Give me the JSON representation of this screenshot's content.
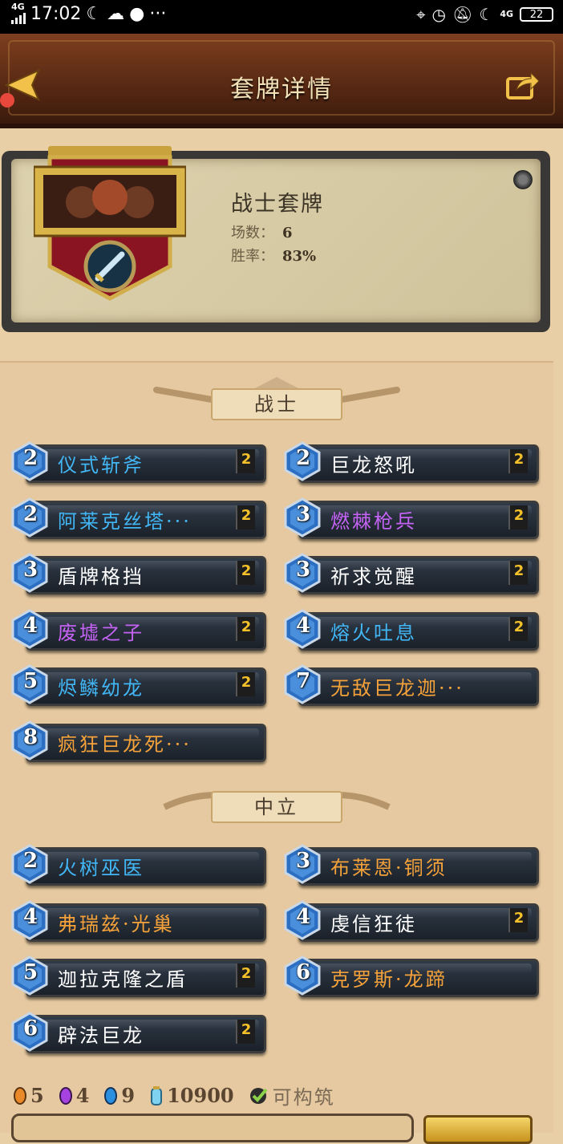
{
  "status_bar": {
    "network": "4G",
    "time": "17:02",
    "icons_left": [
      "moon-icon",
      "cloud-icon",
      "planet-icon",
      "more-icon"
    ],
    "icons_right": [
      "location-icon",
      "alarm-icon",
      "mute-icon",
      "moon-icon",
      "signal-icon"
    ],
    "net_right": "4G",
    "battery": "22"
  },
  "header": {
    "title": "套牌详情"
  },
  "deck": {
    "name": "战士套牌",
    "games_label": "场数：",
    "games_value": "6",
    "winrate_label": "胜率：",
    "winrate_value": "83%"
  },
  "sections": [
    {
      "title": "战士",
      "cards": [
        {
          "cost": "2",
          "name": "仪式斩斧",
          "count": "2",
          "rarity": "rare"
        },
        {
          "cost": "2",
          "name": "巨龙怒吼",
          "count": "2",
          "rarity": "common"
        },
        {
          "cost": "2",
          "name": "阿莱克丝塔···",
          "count": "2",
          "rarity": "rare"
        },
        {
          "cost": "3",
          "name": "燃棘枪兵",
          "count": "2",
          "rarity": "epic"
        },
        {
          "cost": "3",
          "name": "盾牌格挡",
          "count": "2",
          "rarity": "common"
        },
        {
          "cost": "3",
          "name": "祈求觉醒",
          "count": "2",
          "rarity": "common"
        },
        {
          "cost": "4",
          "name": "废墟之子",
          "count": "2",
          "rarity": "epic"
        },
        {
          "cost": "4",
          "name": "熔火吐息",
          "count": "2",
          "rarity": "rare"
        },
        {
          "cost": "5",
          "name": "烬鳞幼龙",
          "count": "2",
          "rarity": "rare"
        },
        {
          "cost": "7",
          "name": "无敌巨龙迦···",
          "count": "",
          "rarity": "legendary"
        },
        {
          "cost": "8",
          "name": "疯狂巨龙死···",
          "count": "",
          "rarity": "legendary"
        }
      ]
    },
    {
      "title": "中立",
      "cards": [
        {
          "cost": "2",
          "name": "火树巫医",
          "count": "",
          "rarity": "rare"
        },
        {
          "cost": "3",
          "name": "布莱恩·铜须",
          "count": "",
          "rarity": "legendary"
        },
        {
          "cost": "4",
          "name": "弗瑞兹·光巢",
          "count": "",
          "rarity": "legendary"
        },
        {
          "cost": "4",
          "name": "虔信狂徒",
          "count": "2",
          "rarity": "common"
        },
        {
          "cost": "5",
          "name": "迦拉克隆之盾",
          "count": "2",
          "rarity": "common"
        },
        {
          "cost": "6",
          "name": "克罗斯·龙蹄",
          "count": "",
          "rarity": "legendary"
        },
        {
          "cost": "6",
          "name": "辟法巨龙",
          "count": "2",
          "rarity": "common"
        }
      ]
    }
  ],
  "footer": {
    "legendary_count": "5",
    "epic_count": "4",
    "rare_count": "9",
    "dust": "10900",
    "craftable_label": "可构筑"
  },
  "colors": {
    "common": "#ffffff",
    "rare": "#42b6f5",
    "epic": "#c563f5",
    "legendary": "#f5a23a",
    "count": "#f4c12a"
  }
}
